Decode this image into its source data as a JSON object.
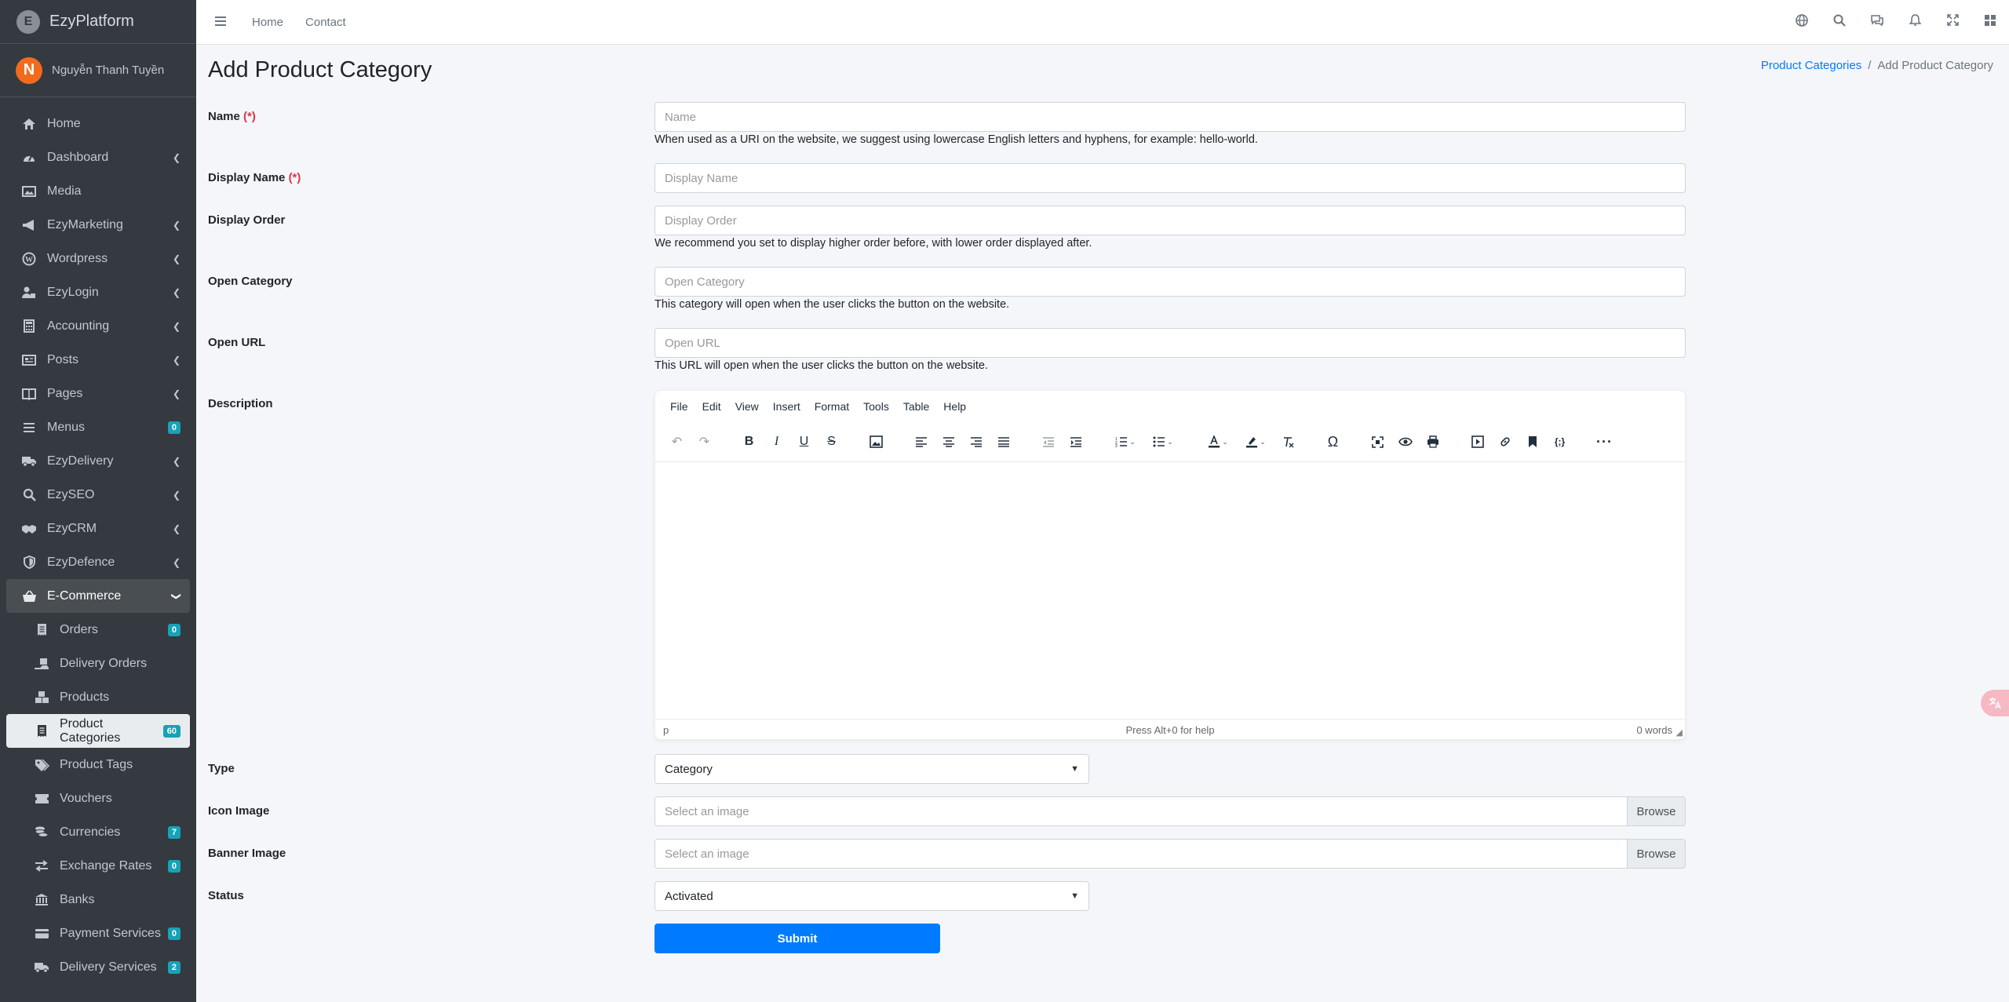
{
  "brand": {
    "name": "EzyPlatform",
    "logo_letter": "E"
  },
  "user": {
    "initial": "N",
    "name": "Nguyễn Thanh Tuyền"
  },
  "sidebar": {
    "items": [
      {
        "label": "Home",
        "icon": "home-icon"
      },
      {
        "label": "Dashboard",
        "icon": "dashboard-icon",
        "chevron": "❮"
      },
      {
        "label": "Media",
        "icon": "media-icon"
      },
      {
        "label": "EzyMarketing",
        "icon": "megaphone-icon",
        "chevron": "❮"
      },
      {
        "label": "Wordpress",
        "icon": "wordpress-icon",
        "chevron": "❮"
      },
      {
        "label": "EzyLogin",
        "icon": "user-lock-icon",
        "chevron": "❮"
      },
      {
        "label": "Accounting",
        "icon": "calculator-icon",
        "chevron": "❮"
      },
      {
        "label": "Posts",
        "icon": "posts-icon",
        "chevron": "❮"
      },
      {
        "label": "Pages",
        "icon": "pages-icon",
        "chevron": "❮"
      },
      {
        "label": "Menus",
        "icon": "menu-icon",
        "badge": "0"
      },
      {
        "label": "EzyDelivery",
        "icon": "truck-icon",
        "chevron": "❮"
      },
      {
        "label": "EzySEO",
        "icon": "seo-search-icon",
        "chevron": "❮"
      },
      {
        "label": "EzyCRM",
        "icon": "handshake-icon",
        "chevron": "❮"
      },
      {
        "label": "EzyDefence",
        "icon": "shield-icon",
        "chevron": "❮"
      },
      {
        "label": "E-Commerce",
        "icon": "basket-icon",
        "chevron": "❯"
      }
    ],
    "sub_items": [
      {
        "label": "Orders",
        "icon": "receipt-icon",
        "badge": "0"
      },
      {
        "label": "Delivery Orders",
        "icon": "delivery-icon"
      },
      {
        "label": "Products",
        "icon": "boxes-icon"
      },
      {
        "label": "Product Categories",
        "icon": "receipt-icon",
        "badge": "60"
      },
      {
        "label": "Product Tags",
        "icon": "tags-icon"
      },
      {
        "label": "Vouchers",
        "icon": "ticket-icon"
      },
      {
        "label": "Currencies",
        "icon": "coins-icon",
        "badge": "7"
      },
      {
        "label": "Exchange Rates",
        "icon": "exchange-icon",
        "badge": "0"
      },
      {
        "label": "Banks",
        "icon": "bank-icon"
      },
      {
        "label": "Payment Services",
        "icon": "card-icon",
        "badge": "0"
      },
      {
        "label": "Delivery Services",
        "icon": "truck-icon",
        "badge": "2"
      }
    ]
  },
  "topbar": {
    "links": [
      "Home",
      "Contact"
    ]
  },
  "page": {
    "title": "Add Product Category",
    "breadcrumb": {
      "parent": "Product Categories",
      "separator": "/",
      "current": "Add Product Category"
    }
  },
  "form": {
    "name": {
      "label": "Name",
      "req_mark": "(*)",
      "placeholder": "Name",
      "help": "When used as a URI on the website, we suggest using lowercase English letters and hyphens, for example: hello-world."
    },
    "display_name": {
      "label": "Display Name",
      "req_mark": "(*)",
      "placeholder": "Display Name"
    },
    "display_order": {
      "label": "Display Order",
      "placeholder": "Display Order",
      "help": "We recommend you set to display higher order before, with lower order displayed after."
    },
    "open_category": {
      "label": "Open Category",
      "placeholder": "Open Category",
      "help": "This category will open when the user clicks the button on the website."
    },
    "open_url": {
      "label": "Open URL",
      "placeholder": "Open URL",
      "help": "This URL will open when the user clicks the button on the website."
    },
    "description": {
      "label": "Description",
      "menubar": [
        "File",
        "Edit",
        "View",
        "Insert",
        "Format",
        "Tools",
        "Table",
        "Help"
      ],
      "status_path": "p",
      "status_help": "Press Alt+0 for help",
      "word_count": "0 words"
    },
    "type": {
      "label": "Type",
      "value": "Category"
    },
    "icon_image": {
      "label": "Icon Image",
      "placeholder": "Select an image",
      "button": "Browse"
    },
    "banner_image": {
      "label": "Banner Image",
      "placeholder": "Select an image",
      "button": "Browse"
    },
    "status": {
      "label": "Status",
      "value": "Activated"
    },
    "submit": "Submit"
  },
  "colors": {
    "sidebar_bg": "#343a40",
    "primary": "#007bff",
    "badge": "#17a2b8",
    "required": "#dc3545",
    "avatar": "#f26b1d"
  }
}
